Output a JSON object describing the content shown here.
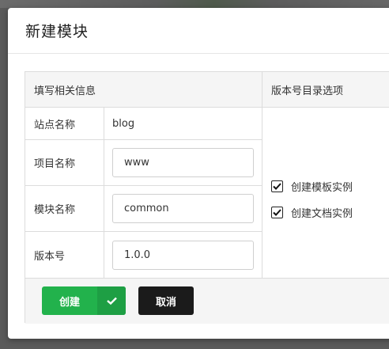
{
  "modal": {
    "title": "新建模块"
  },
  "info_section": {
    "heading": "填写相关信息",
    "site": {
      "label": "站点名称",
      "value": "blog"
    },
    "project": {
      "label": "项目名称",
      "value": "www"
    },
    "module": {
      "label": "模块名称",
      "value": "common"
    },
    "version": {
      "label": "版本号",
      "value": "1.0.0"
    }
  },
  "version_options": {
    "heading": "版本号目录选项",
    "options": [
      {
        "label": "创建模板实例",
        "checked": true
      },
      {
        "label": "创建文档实例",
        "checked": true
      }
    ]
  },
  "footer": {
    "create_label": "创建",
    "cancel_label": "取消"
  },
  "colors": {
    "create_button": "#22b24c",
    "cancel_button": "#1b1b1b",
    "section_header_bg": "#f5f5f5"
  },
  "icons": {
    "create_button_icon": "checkmark-icon",
    "option_checkbox_icon": "checkmark-icon"
  }
}
